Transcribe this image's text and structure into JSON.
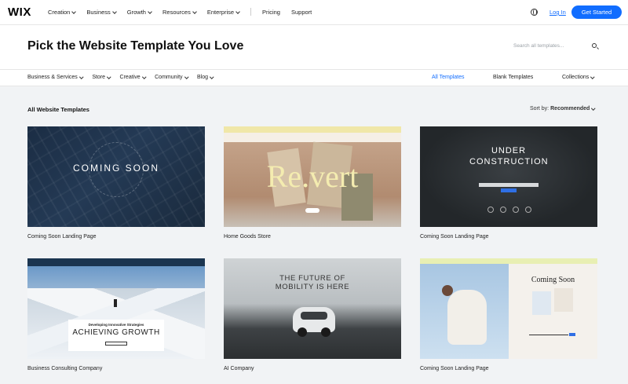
{
  "topnav": {
    "logo": "WIX",
    "items": [
      "Creation",
      "Business",
      "Growth",
      "Resources",
      "Enterprise"
    ],
    "links": [
      "Pricing",
      "Support"
    ],
    "login": "Log In",
    "get_started": "Get Started"
  },
  "header": {
    "title": "Pick the Website Template You Love",
    "search_placeholder": "Search all templates..."
  },
  "categories": {
    "items": [
      "Business & Services",
      "Store",
      "Creative",
      "Community",
      "Blog"
    ],
    "all_templates": "All Templates",
    "blank_templates": "Blank Templates",
    "collections": "Collections"
  },
  "section": {
    "title": "All Website Templates",
    "sort_label": "Sort by:",
    "sort_value": "Recommended"
  },
  "templates": [
    {
      "label": "Coming Soon Landing Page",
      "thumb_text": "COMING SOON"
    },
    {
      "label": "Home Goods Store",
      "thumb_text": "Re.vert"
    },
    {
      "label": "Coming Soon Landing Page",
      "thumb_text": "UNDER CONSTRUCTION"
    },
    {
      "label": "Business Consulting Company",
      "thumb_sub": "Developing Innovative Strategies",
      "thumb_text": "ACHIEVING GROWTH"
    },
    {
      "label": "AI Company",
      "thumb_text": "THE FUTURE OF MOBILITY IS HERE"
    },
    {
      "label": "Coming Soon Landing Page",
      "thumb_text": "Coming Soon"
    }
  ],
  "colors": {
    "accent": "#116dff",
    "page_bg": "#f1f3f5"
  }
}
